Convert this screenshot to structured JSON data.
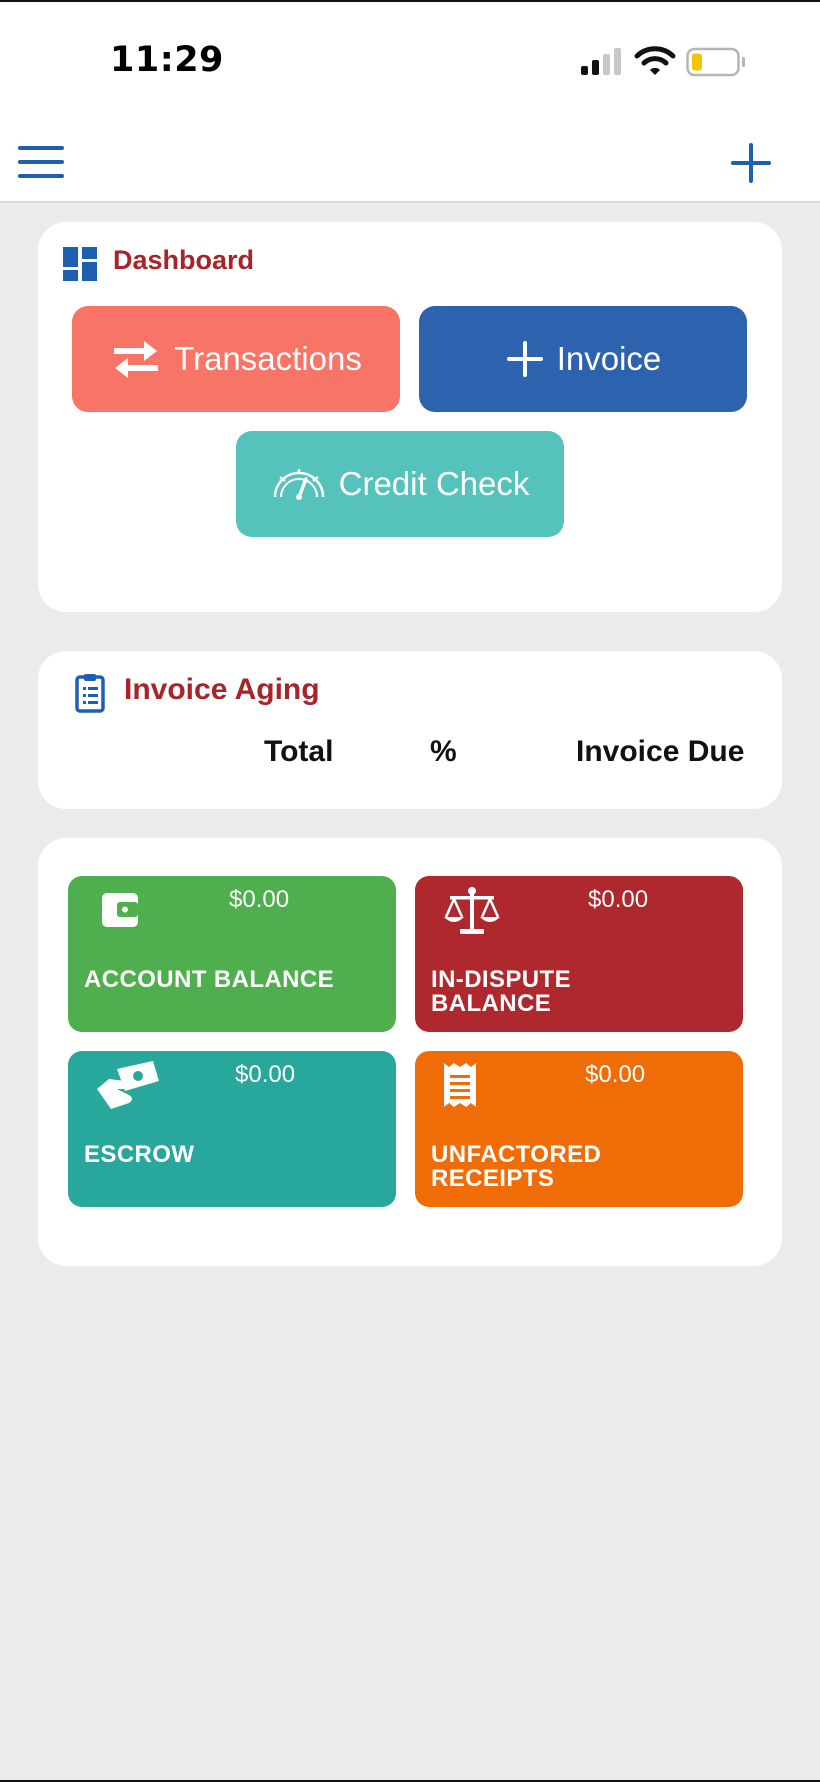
{
  "status_bar": {
    "time": "11:29"
  },
  "header": {
    "menu_icon": "hamburger-menu-icon",
    "add_icon": "plus-icon"
  },
  "dashboard": {
    "title": "Dashboard",
    "icon": "dashboard-grid-icon",
    "buttons": {
      "transactions": {
        "label": "Transactions",
        "icon": "swap-arrows-icon",
        "color": "#f77466"
      },
      "invoice": {
        "label": "Invoice",
        "icon": "plus-icon",
        "color": "#2c62ae"
      },
      "credit_check": {
        "label": "Credit Check",
        "icon": "speedometer-icon",
        "color": "#55c3bb"
      }
    }
  },
  "invoice_aging": {
    "title": "Invoice Aging",
    "icon": "clipboard-list-icon",
    "columns": [
      "Total",
      "%",
      "Invoice Due"
    ]
  },
  "balances": {
    "account_balance": {
      "label": "ACCOUNT BALANCE",
      "amount": "$0.00",
      "icon": "wallet-icon",
      "color": "#4faf4e"
    },
    "in_dispute": {
      "label_line1": "IN-DISPUTE",
      "label_line2": "BALANCE",
      "amount": "$0.00",
      "icon": "scales-icon",
      "color": "#ae282d"
    },
    "escrow": {
      "label": "ESCROW",
      "amount": "$0.00",
      "icon": "money-handshake-icon",
      "color": "#28a79c"
    },
    "unfactored_receipts": {
      "label_line1": "UNFACTORED",
      "label_line2": "RECEIPTS",
      "amount": "$0.00",
      "icon": "receipt-icon",
      "color": "#ef6c06"
    }
  }
}
